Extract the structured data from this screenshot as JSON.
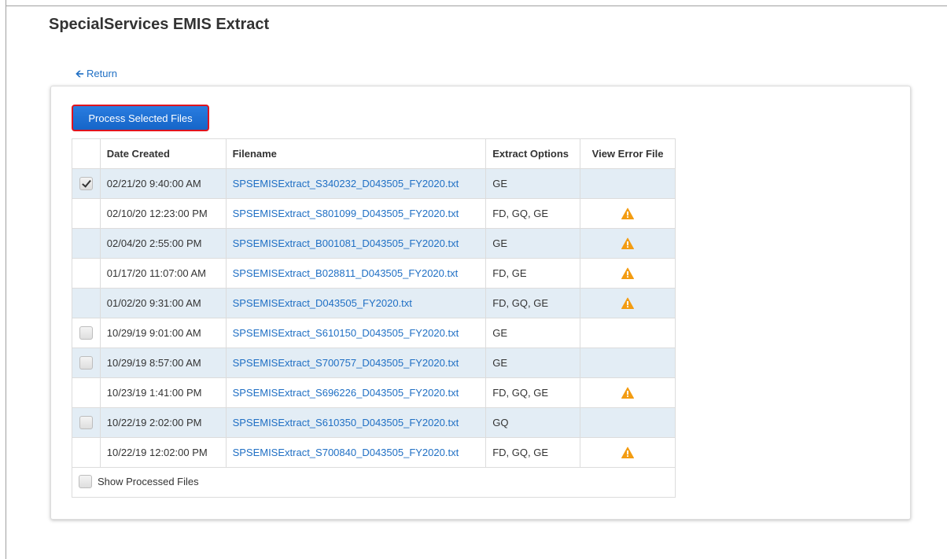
{
  "page": {
    "title": "SpecialServices EMIS Extract",
    "return_label": "Return",
    "process_button_label": "Process Selected Files",
    "show_processed_label": "Show Processed Files"
  },
  "table": {
    "headers": [
      "",
      "Date Created",
      "Filename",
      "Extract Options",
      "View Error File"
    ],
    "rows": [
      {
        "checkbox": "checked",
        "date": "02/21/20 9:40:00 AM",
        "filename": "SPSEMISExtract_S340232_D043505_FY2020.txt",
        "options": "GE",
        "error_icon": false
      },
      {
        "checkbox": "none",
        "date": "02/10/20 12:23:00 PM",
        "filename": "SPSEMISExtract_S801099_D043505_FY2020.txt",
        "options": "FD, GQ, GE",
        "error_icon": true
      },
      {
        "checkbox": "none",
        "date": "02/04/20 2:55:00 PM",
        "filename": "SPSEMISExtract_B001081_D043505_FY2020.txt",
        "options": "GE",
        "error_icon": true
      },
      {
        "checkbox": "none",
        "date": "01/17/20 11:07:00 AM",
        "filename": "SPSEMISExtract_B028811_D043505_FY2020.txt",
        "options": "FD, GE",
        "error_icon": true
      },
      {
        "checkbox": "none",
        "date": "01/02/20 9:31:00 AM",
        "filename": "SPSEMISExtract_D043505_FY2020.txt",
        "options": "FD, GQ, GE",
        "error_icon": true
      },
      {
        "checkbox": "unchecked",
        "date": "10/29/19 9:01:00 AM",
        "filename": "SPSEMISExtract_S610150_D043505_FY2020.txt",
        "options": "GE",
        "error_icon": false
      },
      {
        "checkbox": "unchecked",
        "date": "10/29/19 8:57:00 AM",
        "filename": "SPSEMISExtract_S700757_D043505_FY2020.txt",
        "options": "GE",
        "error_icon": false
      },
      {
        "checkbox": "none",
        "date": "10/23/19 1:41:00 PM",
        "filename": "SPSEMISExtract_S696226_D043505_FY2020.txt",
        "options": "FD, GQ, GE",
        "error_icon": true
      },
      {
        "checkbox": "unchecked",
        "date": "10/22/19 2:02:00 PM",
        "filename": "SPSEMISExtract_S610350_D043505_FY2020.txt",
        "options": "GQ",
        "error_icon": false
      },
      {
        "checkbox": "none",
        "date": "10/22/19 12:02:00 PM",
        "filename": "SPSEMISExtract_S700840_D043505_FY2020.txt",
        "options": "FD, GQ, GE",
        "error_icon": true
      }
    ]
  },
  "colors": {
    "link": "#1f6fc4",
    "primary_button": "#1565c8",
    "highlight_border": "#e0141e",
    "alt_row": "#e3edf5",
    "warning_icon": "#f39c12"
  },
  "icons": {
    "return": "arrow-left-icon",
    "error": "warning-triangle-icon"
  }
}
